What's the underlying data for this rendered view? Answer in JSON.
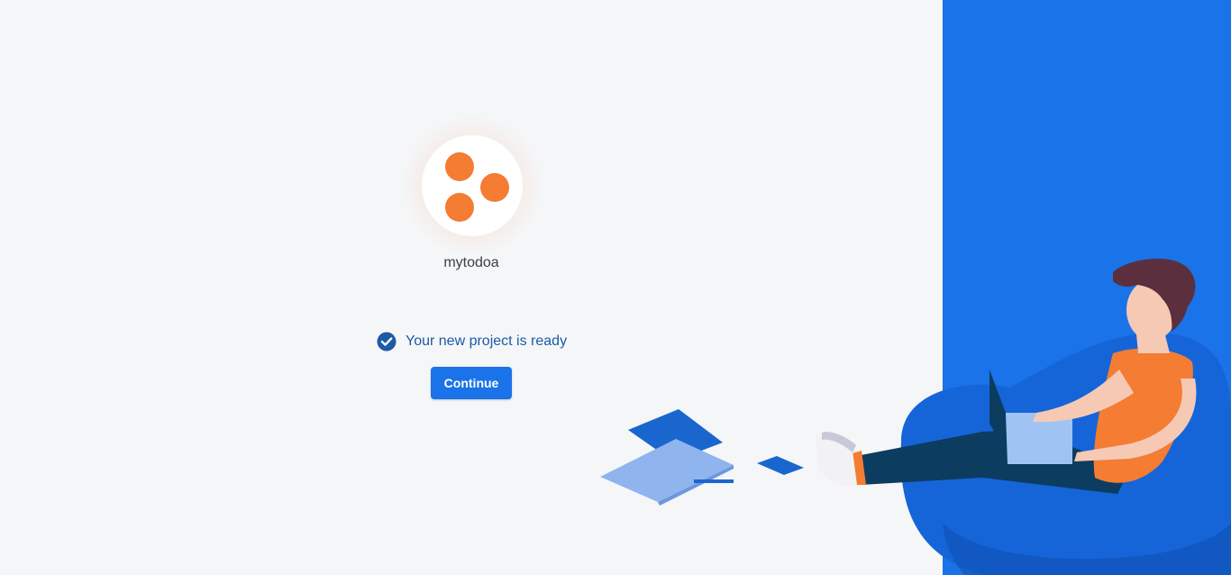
{
  "project": {
    "name": "mytodoa",
    "logo_icon": "three-orange-dots-icon",
    "logo_color": "#f47c33"
  },
  "status": {
    "icon": "check-circle-icon",
    "message": "Your new project is ready"
  },
  "actions": {
    "continue_label": "Continue"
  },
  "theme": {
    "background": "#f5f6f8",
    "accent": "#1a73e8",
    "status_text_color": "#1c5aa6"
  },
  "illustration": {
    "name": "person-on-beanbag-with-laptop-illustration"
  }
}
